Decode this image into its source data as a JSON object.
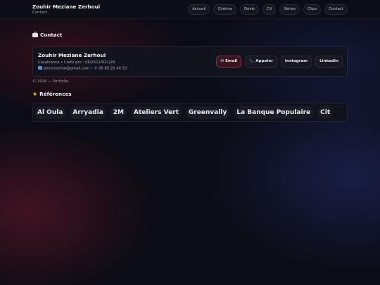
{
  "header": {
    "name": "Zouhir Meziane Zerhoui",
    "subtitle": "Contact",
    "nav": [
      "Accueil",
      "Cinéma",
      "Devis",
      "CV",
      "Séries",
      "Clips",
      "Contact"
    ]
  },
  "contact": {
    "section_title": "Contact",
    "section_icon": "briefcase-icon",
    "name": "Zouhir Meziane Zerhoui",
    "line1": "Casablanca • Carte pro : 06/2512/011/29",
    "email": "phoenixshot@gmail.com",
    "phone": "06 89 20 40 50",
    "separator": "•",
    "buttons": {
      "email": "✉ Email",
      "call": "📞 Appeler",
      "instagram": "Instagram",
      "linkedin": "LinkedIn"
    }
  },
  "footer": {
    "text": "© 2026 — Portfolio."
  },
  "references": {
    "section_title": "Références",
    "section_icon": "star-icon",
    "items": [
      "Al Oula",
      "Arryadia",
      "2M",
      "Ateliers Vert",
      "Greenvally",
      "La Banque Populaire",
      "Cit"
    ]
  },
  "colors": {
    "accent": "#8a2b44",
    "star": "#f5c21a",
    "background": "#0b0c14"
  }
}
